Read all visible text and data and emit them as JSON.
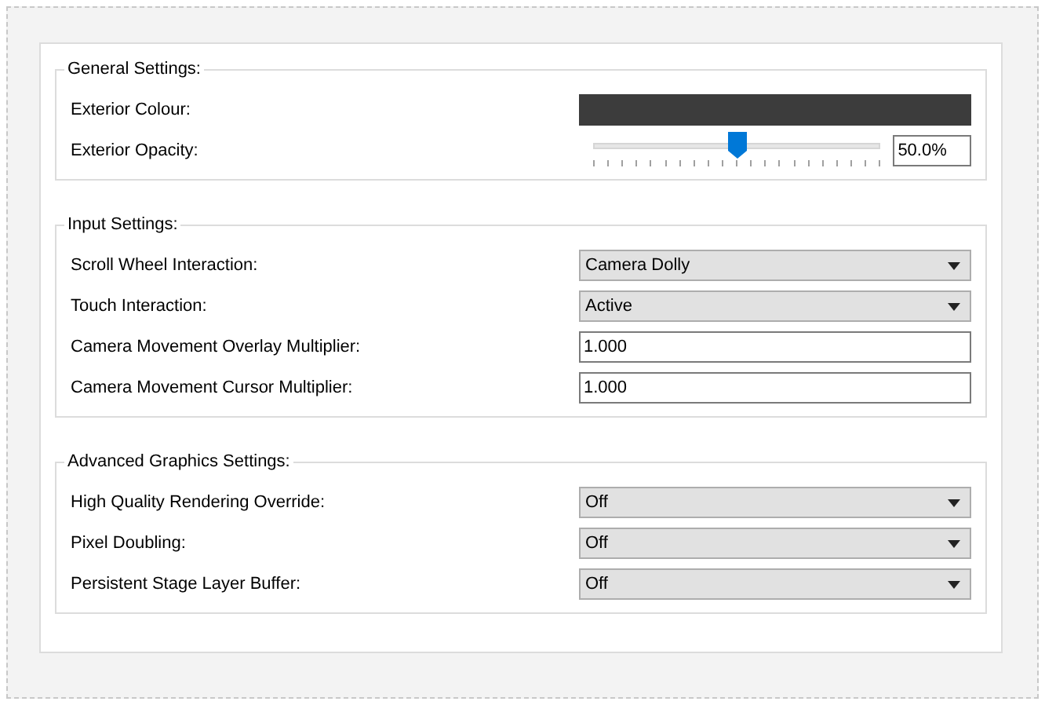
{
  "groups": [
    {
      "title": "General Settings:",
      "rows": [
        {
          "kind": "color",
          "label": "Exterior Colour:",
          "color": "#3c3c3c"
        },
        {
          "kind": "slider",
          "label": "Exterior Opacity:",
          "level": 0.5,
          "value": "50.0%"
        }
      ]
    },
    {
      "title": "Input Settings:",
      "rows": [
        {
          "kind": "dropdown",
          "label": "Scroll Wheel Interaction:",
          "value": "Camera Dolly"
        },
        {
          "kind": "dropdown",
          "label": "Touch Interaction:",
          "value": "Active"
        },
        {
          "kind": "text",
          "label": "Camera Movement Overlay Multiplier:",
          "value": "1.000"
        },
        {
          "kind": "text",
          "label": "Camera Movement Cursor Multiplier:",
          "value": "1.000"
        }
      ]
    },
    {
      "title": "Advanced Graphics Settings:",
      "rows": [
        {
          "kind": "dropdown",
          "label": "High Quality Rendering Override:",
          "value": "Off"
        },
        {
          "kind": "dropdown",
          "label": "Pixel Doubling:",
          "value": "Off"
        },
        {
          "kind": "dropdown",
          "label": "Persistent Stage Layer Buffer:",
          "value": "Off"
        }
      ]
    }
  ]
}
